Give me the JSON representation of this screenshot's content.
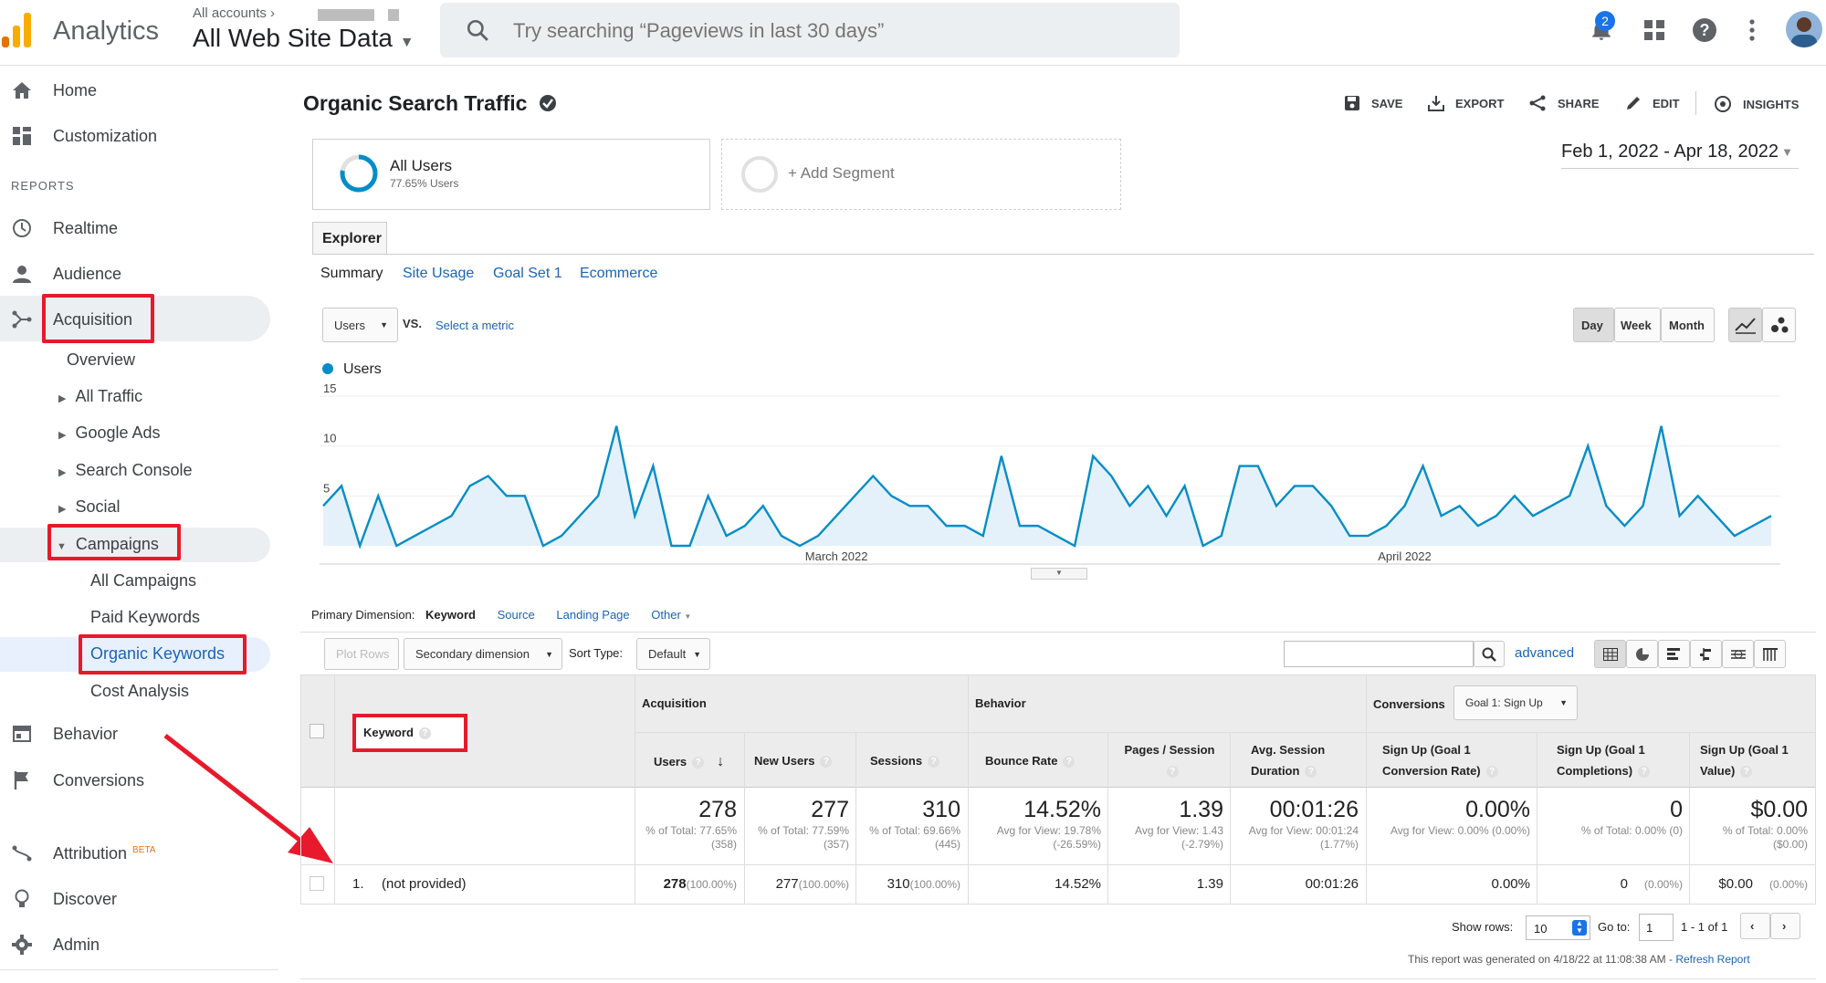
{
  "header": {
    "app_name": "Analytics",
    "breadcrumb": "All accounts",
    "property_name": "All Web Site Data",
    "search_placeholder": "Try searching “Pageviews in last 30 days”",
    "notification_count": "2"
  },
  "sidebar": {
    "home": "Home",
    "customization": "Customization",
    "reports_heading": "REPORTS",
    "realtime": "Realtime",
    "audience": "Audience",
    "acquisition": "Acquisition",
    "overview": "Overview",
    "all_traffic": "All Traffic",
    "google_ads": "Google Ads",
    "search_console": "Search Console",
    "social": "Social",
    "campaigns": "Campaigns",
    "all_campaigns": "All Campaigns",
    "paid_keywords": "Paid Keywords",
    "organic_keywords": "Organic Keywords",
    "cost_analysis": "Cost Analysis",
    "behavior": "Behavior",
    "conversions": "Conversions",
    "attribution": "Attribution",
    "attribution_badge": "BETA",
    "discover": "Discover",
    "admin": "Admin"
  },
  "report": {
    "title": "Organic Search Traffic",
    "actions": {
      "save": "SAVE",
      "export": "EXPORT",
      "share": "SHARE",
      "edit": "EDIT",
      "insights": "INSIGHTS"
    },
    "segment_name": "All Users",
    "segment_sub": "77.65% Users",
    "add_segment": "+ Add Segment",
    "date_range": "Feb 1, 2022 - Apr 18, 2022",
    "explorer_tab": "Explorer",
    "subtabs": [
      "Summary",
      "Site Usage",
      "Goal Set 1",
      "Ecommerce"
    ],
    "metric_select": "Users",
    "vs": "VS.",
    "select_metric": "Select a metric",
    "granularity": [
      "Day",
      "Week",
      "Month"
    ],
    "legend_label": "Users"
  },
  "chart_data": {
    "type": "area",
    "series": [
      {
        "name": "Users",
        "values": [
          4,
          6,
          0,
          5,
          0,
          1,
          2,
          3,
          6,
          7,
          5,
          5,
          0,
          1,
          3,
          5,
          12,
          3,
          8,
          0,
          0,
          5,
          1,
          2,
          4,
          1,
          0,
          1,
          3,
          5,
          7,
          5,
          4,
          4,
          2,
          2,
          1,
          9,
          2,
          2,
          1,
          0,
          9,
          7,
          4,
          6,
          3,
          6,
          0,
          1,
          8,
          8,
          4,
          6,
          6,
          4,
          1,
          1,
          2,
          4,
          8,
          3,
          4,
          2,
          3,
          5,
          3,
          4,
          5,
          10,
          4,
          2,
          4,
          12,
          3,
          5,
          3,
          1,
          2,
          3
        ]
      }
    ],
    "x_labels": [
      "March 2022",
      "April 2022"
    ],
    "y_ticks": [
      "15",
      "10",
      "5"
    ],
    "ylim": [
      0,
      15
    ]
  },
  "table_controls": {
    "primary_dimension_label": "Primary Dimension:",
    "dimensions": [
      "Keyword",
      "Source",
      "Landing Page",
      "Other"
    ],
    "plot_rows": "Plot Rows",
    "secondary_dimension": "Secondary dimension",
    "sort_type_label": "Sort Type:",
    "sort_type": "Default",
    "advanced": "advanced"
  },
  "table": {
    "groups": {
      "acquisition": "Acquisition",
      "behavior": "Behavior",
      "conversions": "Conversions",
      "goal_select": "Goal 1: Sign Up"
    },
    "keyword_header": "Keyword",
    "columns": [
      {
        "label": "Users",
        "total": "278",
        "sub": "% of Total: 77.65% (358)",
        "row": "278",
        "row_pct": "(100.00%)"
      },
      {
        "label": "New Users",
        "total": "277",
        "sub": "% of Total: 77.59% (357)",
        "row": "277",
        "row_pct": "(100.00%)"
      },
      {
        "label": "Sessions",
        "total": "310",
        "sub": "% of Total: 69.66% (445)",
        "row": "310",
        "row_pct": "(100.00%)"
      },
      {
        "label": "Bounce Rate",
        "total": "14.52%",
        "sub": "Avg for View: 19.78% (-26.59%)",
        "row": "14.52%",
        "row_pct": ""
      },
      {
        "label": "Pages / Session",
        "total": "1.39",
        "sub": "Avg for View: 1.43 (-2.79%)",
        "row": "1.39",
        "row_pct": ""
      },
      {
        "label": "Avg. Session Duration",
        "total": "00:01:26",
        "sub": "Avg for View: 00:01:24 (1.77%)",
        "row": "00:01:26",
        "row_pct": ""
      },
      {
        "label": "Sign Up (Goal 1 Conversion Rate)",
        "total": "0.00%",
        "sub": "Avg for View: 0.00% (0.00%)",
        "row": "0.00%",
        "row_pct": ""
      },
      {
        "label": "Sign Up (Goal 1 Completions)",
        "total": "0",
        "sub": "% of Total: 0.00% (0)",
        "row": "0",
        "row_pct": "(0.00%)"
      },
      {
        "label": "Sign Up (Goal 1 Value)",
        "total": "$0.00",
        "sub": "% of Total: 0.00% ($0.00)",
        "row": "$0.00",
        "row_pct": "(0.00%)"
      }
    ],
    "row_index": "1.",
    "row_keyword": "(not provided)"
  },
  "footer": {
    "show_rows_label": "Show rows:",
    "show_rows": "10",
    "goto_label": "Go to:",
    "goto_value": "1",
    "range": "1 - 1 of 1",
    "generated": "This report was generated on 4/18/22 at 11:08:38 AM -",
    "refresh": "Refresh Report"
  },
  "colors": {
    "accent": "#1a73e8",
    "series": "#1f77b4",
    "highlight": "#e8192c"
  }
}
